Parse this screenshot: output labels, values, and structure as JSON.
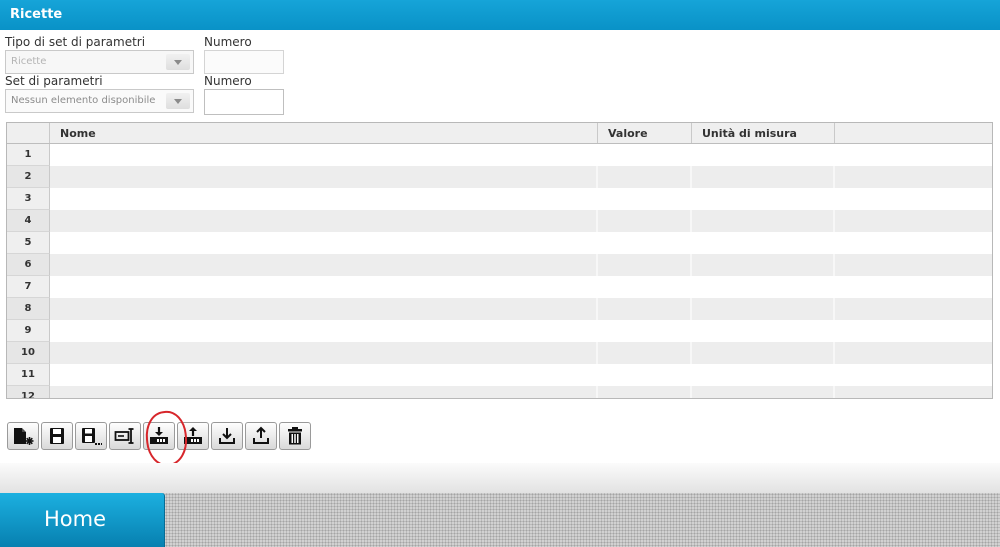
{
  "window": {
    "title": "Ricette"
  },
  "form": {
    "type_label": "Tipo di set di parametri",
    "type_value": "Ricette",
    "number_label_1": "Numero",
    "set_label": "Set di parametri",
    "set_placeholder": "Nessun elemento disponibile",
    "number_label_2": "Numero"
  },
  "table": {
    "columns": [
      "Nome",
      "Valore",
      "Unità di misura",
      ""
    ],
    "row_numbers": [
      "1",
      "2",
      "3",
      "4",
      "5",
      "6",
      "7",
      "8",
      "9",
      "10",
      "11",
      "12"
    ]
  },
  "toolbar": {
    "buttons": [
      {
        "icon": "new-recipe-icon"
      },
      {
        "icon": "save-icon"
      },
      {
        "icon": "save-as-icon"
      },
      {
        "icon": "rename-icon"
      },
      {
        "icon": "write-to-plc-icon",
        "highlighted": true
      },
      {
        "icon": "read-from-plc-icon"
      },
      {
        "icon": "import-icon"
      },
      {
        "icon": "export-icon"
      },
      {
        "icon": "delete-icon"
      }
    ]
  },
  "navigation": {
    "home_label": "Home"
  },
  "colors": {
    "accent": "#0992c7",
    "home_button": "#1aa8d8",
    "annotation": "#d7262b"
  }
}
